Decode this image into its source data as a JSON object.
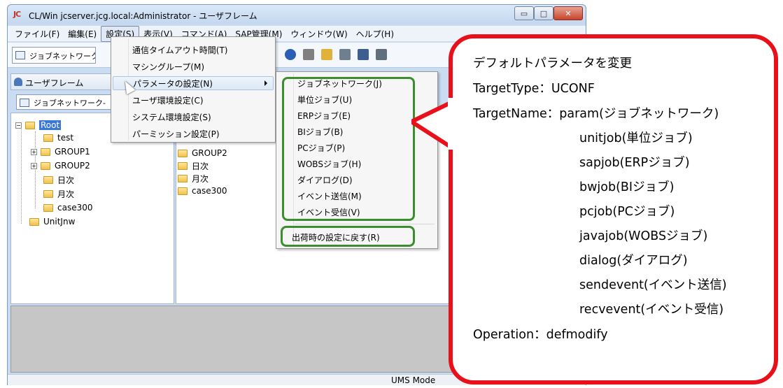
{
  "window": {
    "logo": "JC",
    "title": "CL/Win jcserver.jcg.local:Administrator - ユーザフレーム",
    "buttons": {
      "minimize": "▭",
      "maximize": "□",
      "close": "✕"
    }
  },
  "menubar": [
    "ファイル(F)",
    "編集(E)",
    "設定(S)",
    "表示(V)",
    "コマンド(A)",
    "SAP管理(M)",
    "ウィンドウ(W)",
    "ヘルプ(H)"
  ],
  "toolbar": {
    "combo_value": "ジョブネットワーク一覧(",
    "icons": [
      "help-icon",
      "document-icon",
      "new-document-icon",
      "edit-document-icon",
      "job-icon",
      "refresh-icon"
    ]
  },
  "user_pane": {
    "title": "ユーザフレーム",
    "combo_value": "ジョブネットワーク-"
  },
  "tree": {
    "root": "Root",
    "children": [
      "test",
      "GROUP1",
      "GROUP2",
      "日次",
      "月次",
      "case300"
    ],
    "sibling": "UnitJnw"
  },
  "list": {
    "items": [
      "GROUP2",
      "日次",
      "月次",
      "case300"
    ]
  },
  "settings_menu": {
    "items": [
      "通信タイムアウト時間(T)",
      "マシングループ(M)",
      "パラメータの設定(N)",
      "ユーザ環境設定(C)",
      "システム環境設定(S)",
      "パーミッション設定(P)"
    ]
  },
  "params_menu": {
    "items": [
      "ジョブネットワーク(J)",
      "単位ジョブ(U)",
      "ERPジョブ(E)",
      "BIジョブ(B)",
      "PCジョブ(P)",
      "WOBSジョブ(H)",
      "ダイアログ(D)",
      "イベント送信(M)",
      "イベント受信(V)"
    ],
    "reset": "出荷時の設定に戻す(R)"
  },
  "status": {
    "mode": "UMS Mode"
  },
  "callout": {
    "heading": "デフォルトパラメータを変更",
    "target_type": "TargetType：UCONF",
    "target_name_first": "TargetName：param(ジョブネットワーク)",
    "target_names": [
      "unitjob(単位ジョブ)",
      "sapjob(ERPジョブ)",
      "bwjob(BIジョブ)",
      "pcjob(PCジョブ)",
      "javajob(WOBSジョブ)",
      "dialog(ダイアログ)",
      "sendevent(イベント送信)",
      "recvevent(イベント受信)"
    ],
    "operation": "Operation：defmodify"
  },
  "colors": {
    "callout_border": "#e8101a",
    "highlight_box": "#3b8e2e",
    "selection": "#3a78d6"
  }
}
